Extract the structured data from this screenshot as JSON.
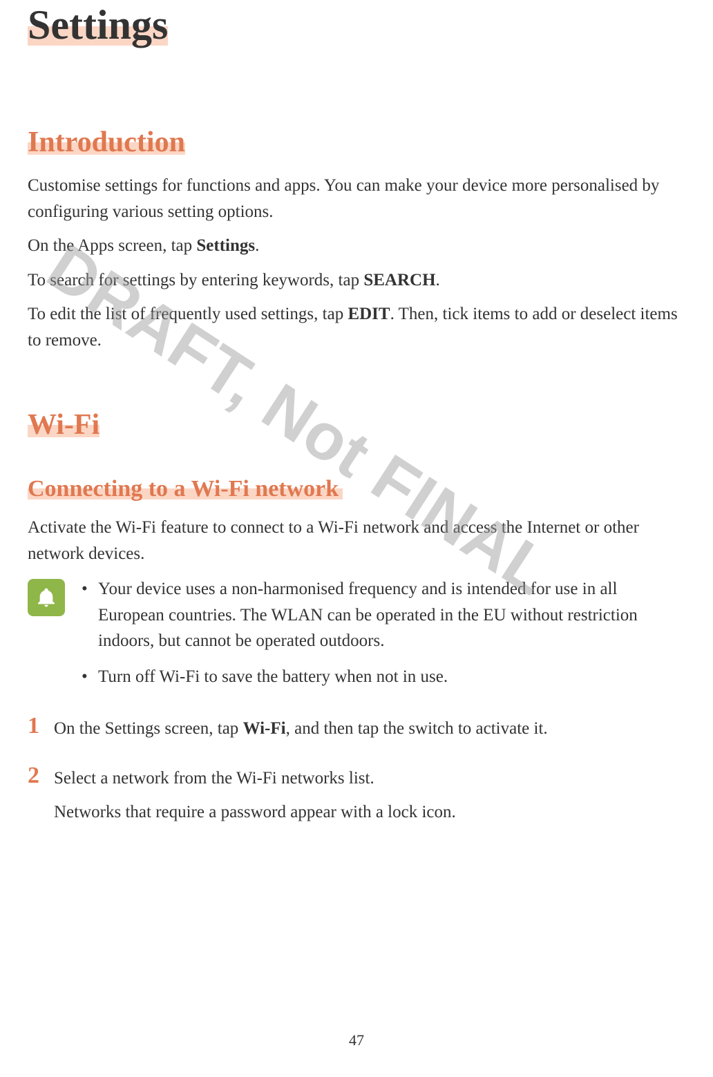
{
  "chapter": {
    "title": "Settings"
  },
  "sections": {
    "introduction": {
      "heading": "Introduction",
      "para1": "Customise settings for functions and apps. You can make your device more personalised by configuring various setting options.",
      "para2_prefix": "On the Apps screen, tap ",
      "para2_bold": "Settings",
      "para2_suffix": ".",
      "para3_prefix": "To search for settings by entering keywords, tap ",
      "para3_bold": "SEARCH",
      "para3_suffix": ".",
      "para4_prefix": "To edit the list of frequently used settings, tap ",
      "para4_bold": "EDIT",
      "para4_suffix": ". Then, tick items to add or deselect items to remove."
    },
    "wifi": {
      "heading": "Wi-Fi",
      "subheading": "Connecting to a Wi-Fi network",
      "intro": "Activate the Wi-Fi feature to connect to a Wi-Fi network and access the Internet or other network devices.",
      "note_items": [
        "Your device uses a non-harmonised frequency and is intended for use in all European countries. The WLAN can be operated in the EU without restriction indoors, but cannot be operated outdoors.",
        "Turn off Wi-Fi to save the battery when not in use."
      ],
      "steps": [
        {
          "num": "1",
          "prefix": "On the Settings screen, tap ",
          "bold": "Wi-Fi",
          "suffix": ", and then tap the switch to activate it."
        },
        {
          "num": "2",
          "line1": "Select a network from the Wi-Fi networks list.",
          "line2": "Networks that require a password appear with a lock icon."
        }
      ]
    }
  },
  "watermark": "DRAFT, Not FINAL",
  "page_number": "47"
}
